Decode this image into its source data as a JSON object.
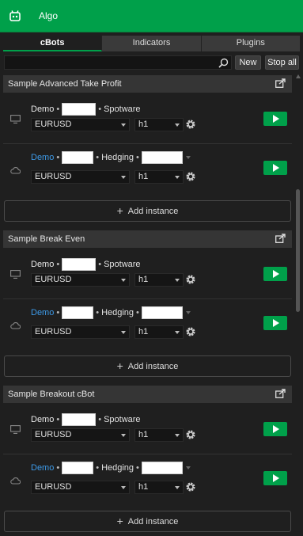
{
  "app": {
    "title": "Algo"
  },
  "tabs": [
    {
      "label": "cBots",
      "active": true
    },
    {
      "label": "Indicators"
    },
    {
      "label": "Plugins"
    }
  ],
  "search": {
    "value": "",
    "placeholder": ""
  },
  "toolbar": {
    "new_label": "New",
    "stop_all_label": "Stop all"
  },
  "bots": [
    {
      "name": "Sample Advanced Take Profit",
      "instances": [
        {
          "env": "desktop",
          "account_label": "Demo",
          "bullet": "•",
          "broker": "Spotware",
          "symbol": "EURUSD",
          "timeframe": "h1"
        },
        {
          "env": "cloud",
          "account_label": "Demo",
          "bullet": "•",
          "account_type": "Hedging",
          "symbol": "EURUSD",
          "timeframe": "h1"
        }
      ],
      "add_label": "Add instance"
    },
    {
      "name": "Sample Break Even",
      "instances": [
        {
          "env": "desktop",
          "account_label": "Demo",
          "bullet": "•",
          "broker": "Spotware",
          "symbol": "EURUSD",
          "timeframe": "h1"
        },
        {
          "env": "cloud",
          "account_label": "Demo",
          "bullet": "•",
          "account_type": "Hedging",
          "symbol": "EURUSD",
          "timeframe": "h1"
        }
      ],
      "add_label": "Add instance"
    },
    {
      "name": "Sample Breakout cBot",
      "instances": [
        {
          "env": "desktop",
          "account_label": "Demo",
          "bullet": "•",
          "broker": "Spotware",
          "symbol": "EURUSD",
          "timeframe": "h1"
        },
        {
          "env": "cloud",
          "account_label": "Demo",
          "bullet": "•",
          "account_type": "Hedging",
          "symbol": "EURUSD",
          "timeframe": "h1"
        }
      ],
      "add_label": "Add instance"
    }
  ],
  "colors": {
    "accent": "#00a04a",
    "link_blue": "#3d9ae8",
    "background": "#1f1f1f",
    "header_bar": "#353535"
  },
  "icons": {
    "app": "robot-icon",
    "search": "search-icon",
    "share": "share-icon",
    "desktop": "monitor-icon",
    "cloud": "cloud-icon",
    "settings": "gear-icon",
    "run": "play-icon",
    "add": "plus-icon"
  }
}
